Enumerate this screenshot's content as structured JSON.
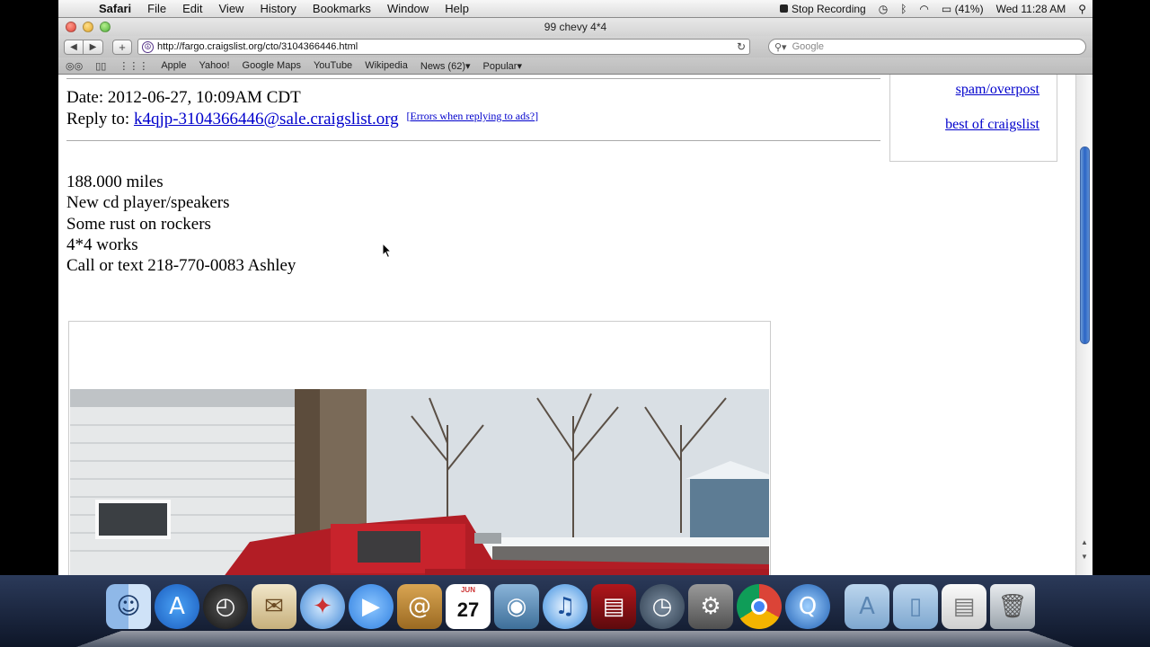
{
  "menubar": {
    "apple": "",
    "app_name": "Safari",
    "menus": [
      "File",
      "Edit",
      "View",
      "History",
      "Bookmarks",
      "Window",
      "Help"
    ],
    "stop_recording": "Stop Recording",
    "battery": "(41%)",
    "clock": "Wed 11:28 AM"
  },
  "window": {
    "title": "99 chevy 4*4"
  },
  "toolbar": {
    "url": "http://fargo.craigslist.org/cto/3104366446.html",
    "search_placeholder": "Google"
  },
  "bookmarks": [
    "Apple",
    "Yahoo!",
    "Google Maps",
    "YouTube",
    "Wikipedia",
    "News (62)▾",
    "Popular▾"
  ],
  "page": {
    "date_line": "Date: 2012-06-27, 10:09AM CDT",
    "reply_label": "Reply to: ",
    "reply_email": "k4qjp-3104366446@sale.craigslist.org",
    "errors_link_open": "[",
    "errors_link": "Errors when replying to ads?",
    "errors_link_close": "]",
    "body": [
      "188.000 miles",
      "New cd player/speakers",
      "Some rust on rockers",
      "4*4 works",
      "Call or text 218-770-0083 Ashley"
    ],
    "sidebar_links": [
      "spam/overpost",
      "best of craigslist"
    ]
  },
  "dock": {
    "calendar_day": "27",
    "calendar_month": "JUN",
    "icons": [
      "finder-icon",
      "app-store-icon",
      "dashboard-icon",
      "mail-icon",
      "safari-icon",
      "ichat-icon",
      "address-book-icon",
      "ical-icon",
      "iphoto-icon",
      "itunes-icon",
      "photo-booth-icon",
      "time-machine-icon",
      "system-preferences-icon",
      "chrome-icon",
      "quicktime-icon",
      "applications-folder-icon",
      "documents-folder-icon",
      "downloads-stack-icon",
      "trash-icon"
    ]
  }
}
